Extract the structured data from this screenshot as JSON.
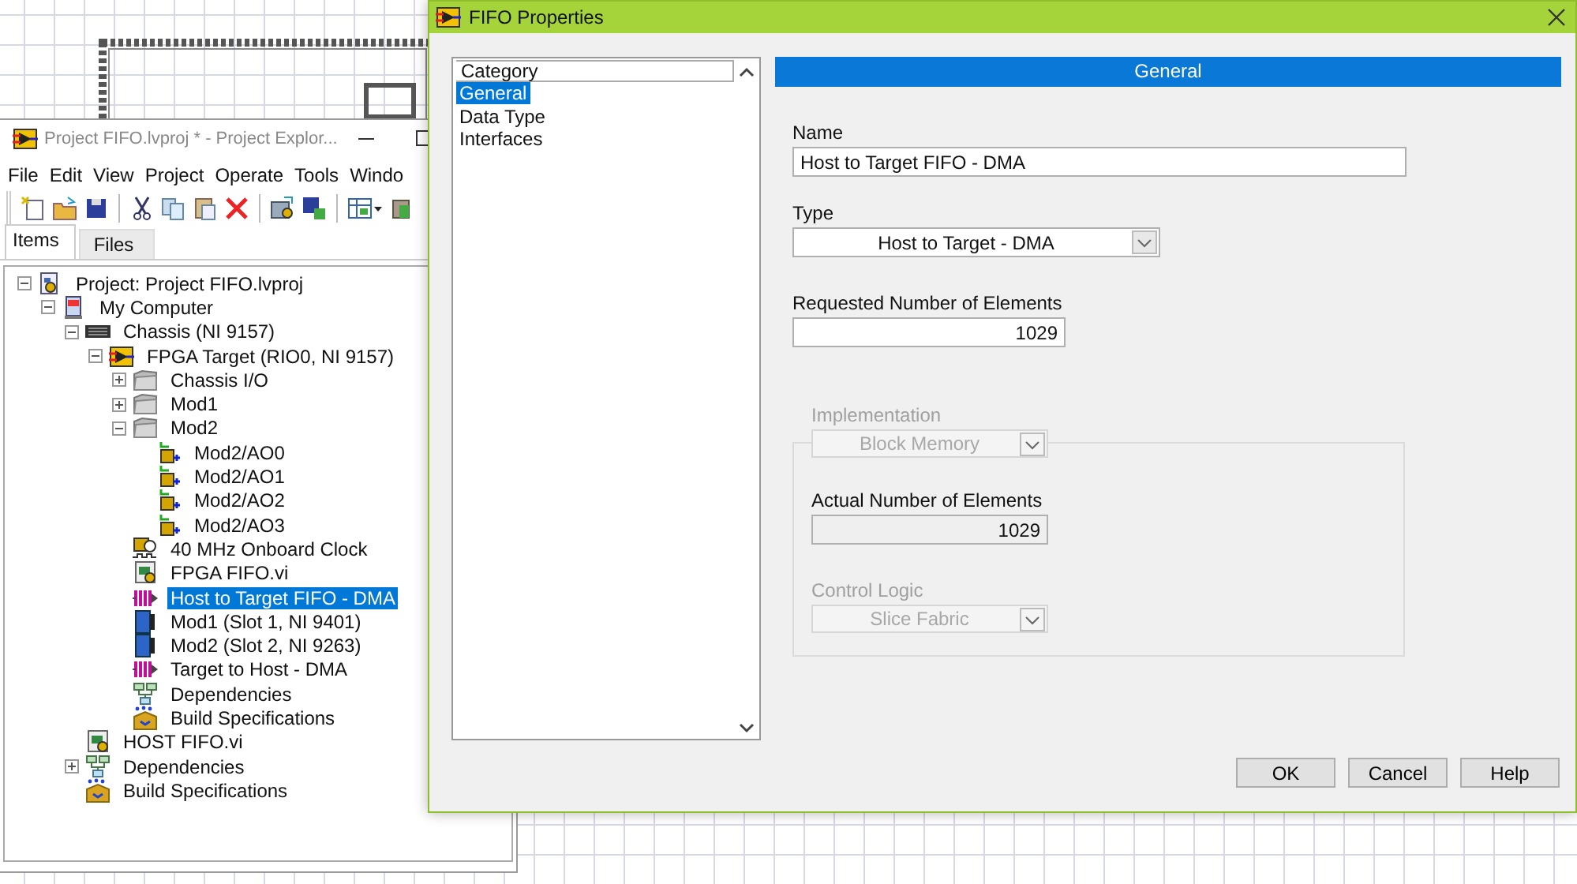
{
  "explorer": {
    "title": "Project FIFO.lvproj * - Project Explor...",
    "menu": [
      "File",
      "Edit",
      "View",
      "Project",
      "Operate",
      "Tools",
      "Windo"
    ],
    "tabs": [
      {
        "label": "Items",
        "selected": true
      },
      {
        "label": "Files",
        "selected": false
      }
    ],
    "tree": [
      {
        "label": "Project: Project FIFO.lvproj",
        "kind": "project",
        "expanded": true,
        "selected": false,
        "children": [
          {
            "label": "My Computer",
            "kind": "computer",
            "expanded": true,
            "selected": false,
            "children": [
              {
                "label": "Chassis (NI 9157)",
                "kind": "chassis",
                "expanded": true,
                "selected": false,
                "children": [
                  {
                    "label": "FPGA Target (RIO0, NI 9157)",
                    "kind": "fpga",
                    "expanded": true,
                    "selected": false,
                    "children": [
                      {
                        "label": "Chassis I/O",
                        "kind": "folder",
                        "expanded": false,
                        "selected": false
                      },
                      {
                        "label": "Mod1",
                        "kind": "folder",
                        "expanded": false,
                        "selected": false
                      },
                      {
                        "label": "Mod2",
                        "kind": "folder",
                        "expanded": true,
                        "selected": false,
                        "children": [
                          {
                            "label": "Mod2/AO0",
                            "kind": "io",
                            "selected": false
                          },
                          {
                            "label": "Mod2/AO1",
                            "kind": "io",
                            "selected": false
                          },
                          {
                            "label": "Mod2/AO2",
                            "kind": "io",
                            "selected": false
                          },
                          {
                            "label": "Mod2/AO3",
                            "kind": "io",
                            "selected": false
                          }
                        ]
                      },
                      {
                        "label": "40 MHz Onboard Clock",
                        "kind": "clock",
                        "selected": false
                      },
                      {
                        "label": "FPGA FIFO.vi",
                        "kind": "vi",
                        "selected": false
                      },
                      {
                        "label": "Host to Target FIFO - DMA",
                        "kind": "fifo",
                        "selected": true
                      },
                      {
                        "label": "Mod1 (Slot 1, NI 9401)",
                        "kind": "module",
                        "selected": false
                      },
                      {
                        "label": "Mod2 (Slot 2, NI 9263)",
                        "kind": "module",
                        "selected": false
                      },
                      {
                        "label": "Target to Host - DMA",
                        "kind": "fifo",
                        "selected": false
                      },
                      {
                        "label": "Dependencies",
                        "kind": "dependencies",
                        "selected": false
                      },
                      {
                        "label": "Build Specifications",
                        "kind": "build",
                        "selected": false
                      }
                    ]
                  }
                ]
              },
              {
                "label": "HOST FIFO.vi",
                "kind": "vi",
                "selected": false
              },
              {
                "label": "Dependencies",
                "kind": "dependencies",
                "expanded": false,
                "selected": false
              },
              {
                "label": "Build Specifications",
                "kind": "build",
                "selected": false
              }
            ]
          }
        ]
      }
    ]
  },
  "dialog": {
    "title": "FIFO Properties",
    "category_header": "Category",
    "categories": [
      {
        "label": "General",
        "selected": true
      },
      {
        "label": "Data Type",
        "selected": false
      },
      {
        "label": "Interfaces",
        "selected": false
      }
    ],
    "section_title": "General",
    "fields": {
      "name": {
        "label": "Name",
        "value": "Host to Target FIFO - DMA",
        "kind": "text",
        "disabled": false,
        "read_only": false
      },
      "type": {
        "label": "Type",
        "value": "Host to Target - DMA",
        "kind": "select",
        "disabled": false
      },
      "requested": {
        "label": "Requested Number of Elements",
        "value": "1029",
        "kind": "number",
        "disabled": false,
        "read_only": false
      },
      "implementation": {
        "label": "Implementation",
        "value": "Block Memory",
        "kind": "select",
        "disabled": true
      },
      "actual": {
        "label": "Actual Number of Elements",
        "value": "1029",
        "kind": "number",
        "disabled": false,
        "read_only": true
      },
      "control_logic": {
        "label": "Control Logic",
        "value": "Slice Fabric",
        "kind": "select",
        "disabled": true
      }
    },
    "buttons": [
      "OK",
      "Cancel",
      "Help"
    ]
  }
}
